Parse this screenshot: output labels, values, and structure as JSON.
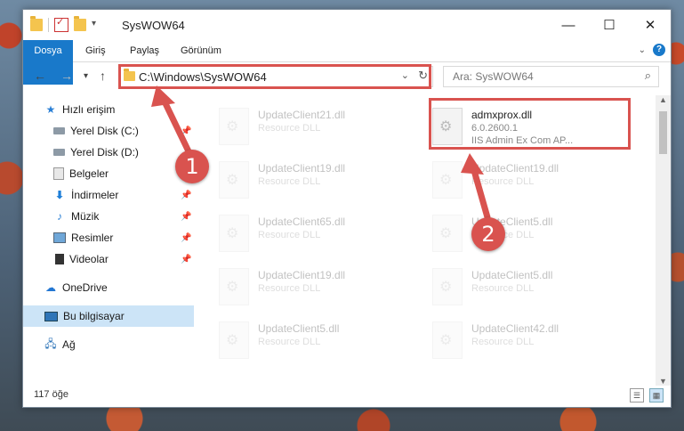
{
  "window": {
    "title": "SysWOW64",
    "controls": {
      "minimize": "—",
      "maximize": "☐",
      "close": "✕"
    }
  },
  "ribbon": {
    "tabs": [
      "Dosya",
      "Giriş",
      "Paylaş",
      "Görünüm"
    ]
  },
  "address": {
    "path": "C:\\Windows\\SysWOW64",
    "search_placeholder": "Ara: SysWOW64"
  },
  "nav": {
    "items": [
      {
        "label": "Hızlı erişim",
        "icon": "star-icon",
        "pinned": false
      },
      {
        "label": "Yerel Disk (C:)",
        "icon": "drive-icon",
        "pinned": true
      },
      {
        "label": "Yerel Disk (D:)",
        "icon": "drive-icon",
        "pinned": false
      },
      {
        "label": "Belgeler",
        "icon": "documents-icon",
        "pinned": false
      },
      {
        "label": "İndirmeler",
        "icon": "download-icon",
        "pinned": true
      },
      {
        "label": "Müzik",
        "icon": "music-icon",
        "pinned": true
      },
      {
        "label": "Resimler",
        "icon": "pictures-icon",
        "pinned": true
      },
      {
        "label": "Videolar",
        "icon": "videos-icon",
        "pinned": true
      },
      {
        "label": "OneDrive",
        "icon": "onedrive-icon",
        "pinned": false
      },
      {
        "label": "Bu bilgisayar",
        "icon": "this-pc-icon",
        "pinned": false,
        "selected": true
      },
      {
        "label": "Ağ",
        "icon": "network-icon",
        "pinned": false
      }
    ]
  },
  "files": [
    {
      "name": "UpdateClient21.dll",
      "type": "Resource DLL"
    },
    {
      "name": "admxprox.dll",
      "version": "6.0.2600.1",
      "description": "IIS Admin Ex Com AP...",
      "highlighted": true
    },
    {
      "name": "UpdateClient19.dll",
      "type": "Resource DLL"
    },
    {
      "name": "UpdateClient19.dll",
      "type": "Resource DLL"
    },
    {
      "name": "UpdateClient65.dll",
      "type": "Resource DLL"
    },
    {
      "name": "UpdateClient5.dll",
      "type": "Resource DLL"
    },
    {
      "name": "UpdateClient19.dll",
      "type": "Resource DLL"
    },
    {
      "name": "UpdateClient5.dll",
      "type": "Resource DLL"
    },
    {
      "name": "UpdateClient5.dll",
      "type": "Resource DLL"
    },
    {
      "name": "UpdateClient42.dll",
      "type": "Resource DLL"
    }
  ],
  "status": {
    "item_count": "117 öğe"
  },
  "annotations": {
    "badge1": "1",
    "badge2": "2",
    "color": "#d9534f"
  }
}
